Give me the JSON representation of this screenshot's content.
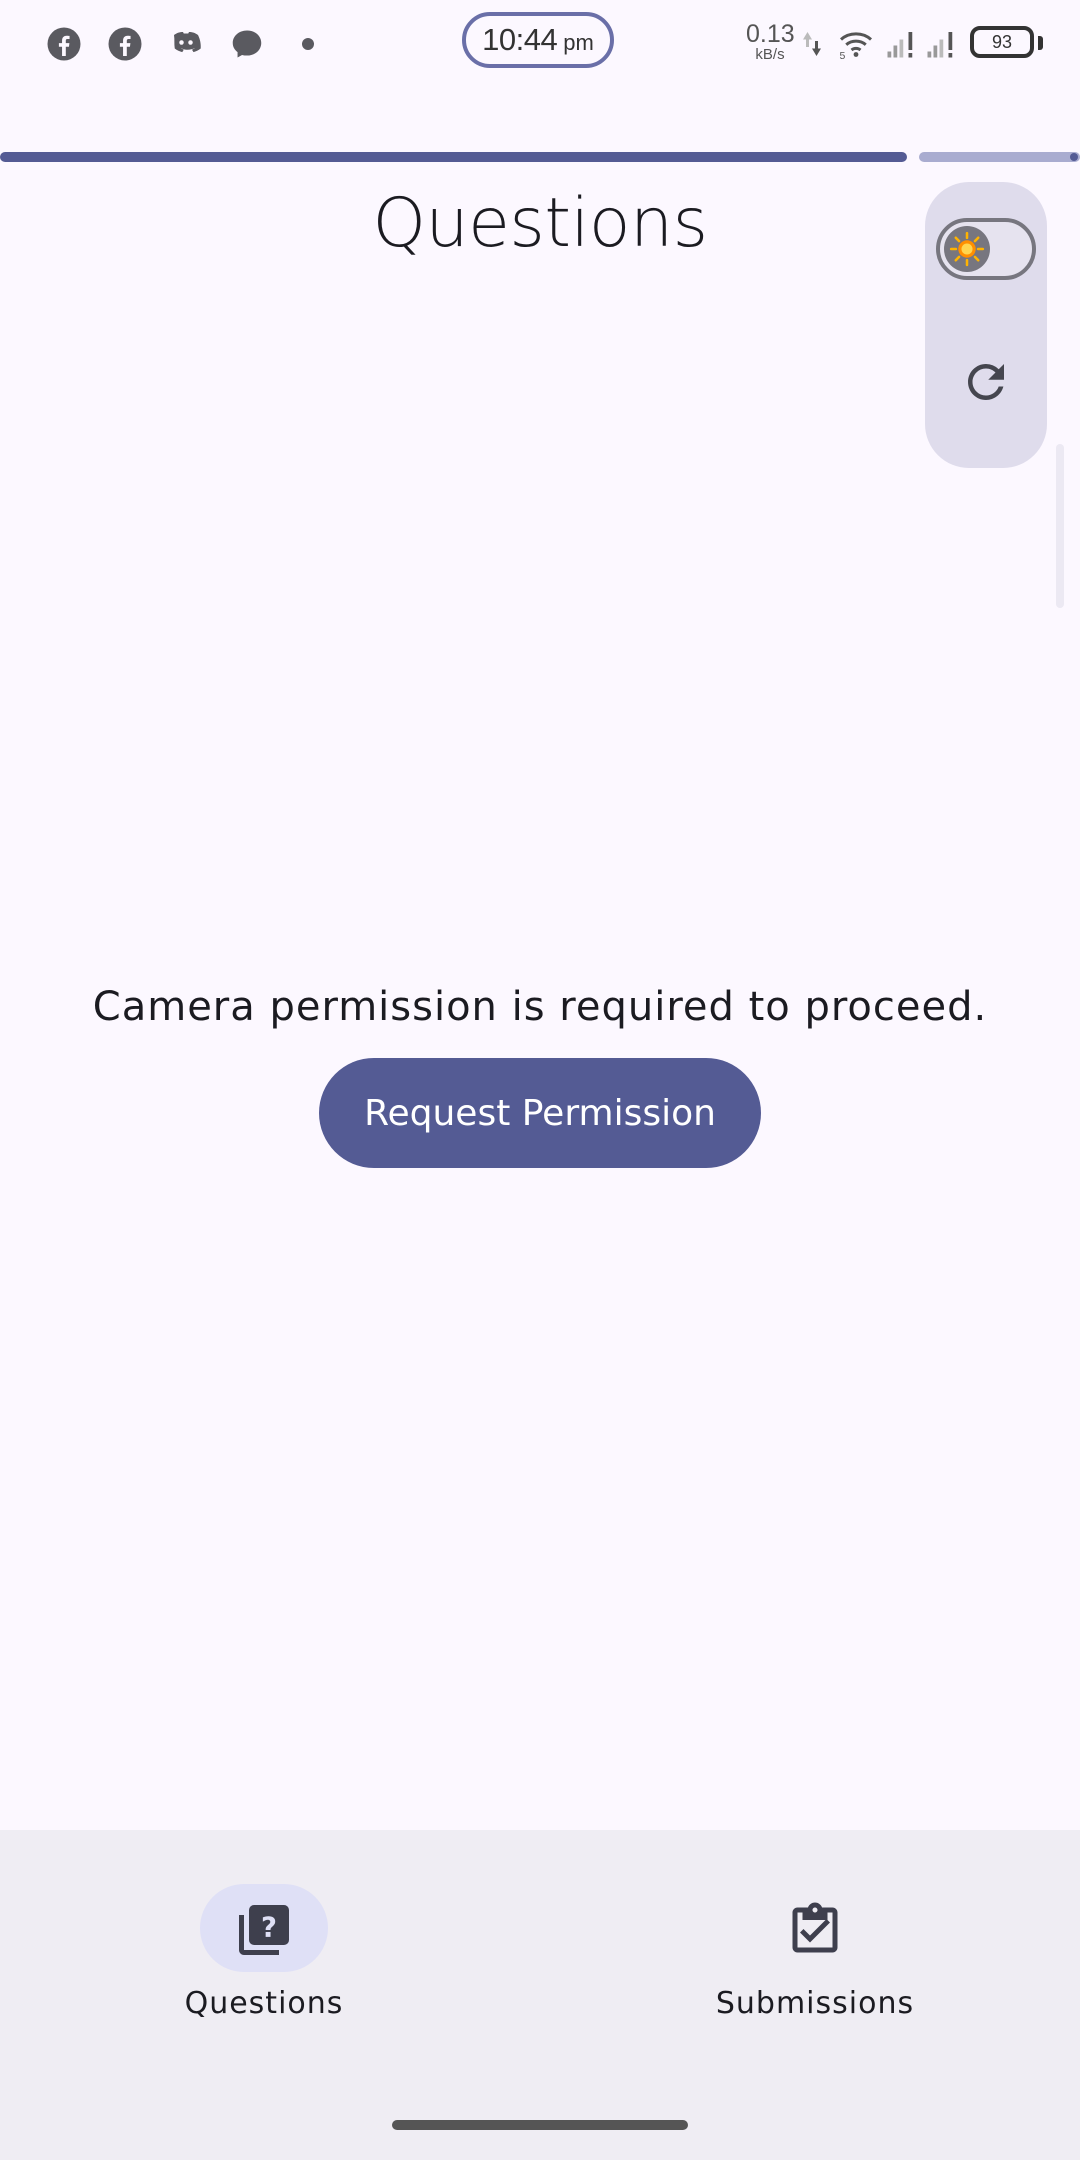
{
  "status_bar": {
    "time": "10:44",
    "ampm": "pm",
    "net_speed_value": "0.13",
    "net_speed_unit": "kB/s",
    "battery": "93",
    "notification_icons": [
      "facebook-icon",
      "facebook-icon",
      "discord-icon",
      "messenger-icon",
      "more-dot-icon"
    ],
    "right_icons": [
      "data-arrows-icon",
      "wifi-icon",
      "signal-icon",
      "signal-icon",
      "battery-icon"
    ]
  },
  "progress": {
    "fraction": 0.84
  },
  "header": {
    "title": "Questions"
  },
  "toolbar": {
    "theme_toggle": {
      "icon": "sun-icon",
      "state": "light"
    },
    "refresh": {
      "icon": "refresh-icon"
    }
  },
  "permission": {
    "message": "Camera permission is required to proceed.",
    "button_label": "Request Permission"
  },
  "bottom_nav": {
    "items": [
      {
        "label": "Questions",
        "icon": "question-library-icon",
        "active": true
      },
      {
        "label": "Submissions",
        "icon": "clipboard-check-icon",
        "active": false
      }
    ]
  },
  "colors": {
    "primary": "#545b94",
    "background": "#fcf8ff",
    "nav_background": "#efedf3",
    "active_pill": "#dfe0f6"
  }
}
